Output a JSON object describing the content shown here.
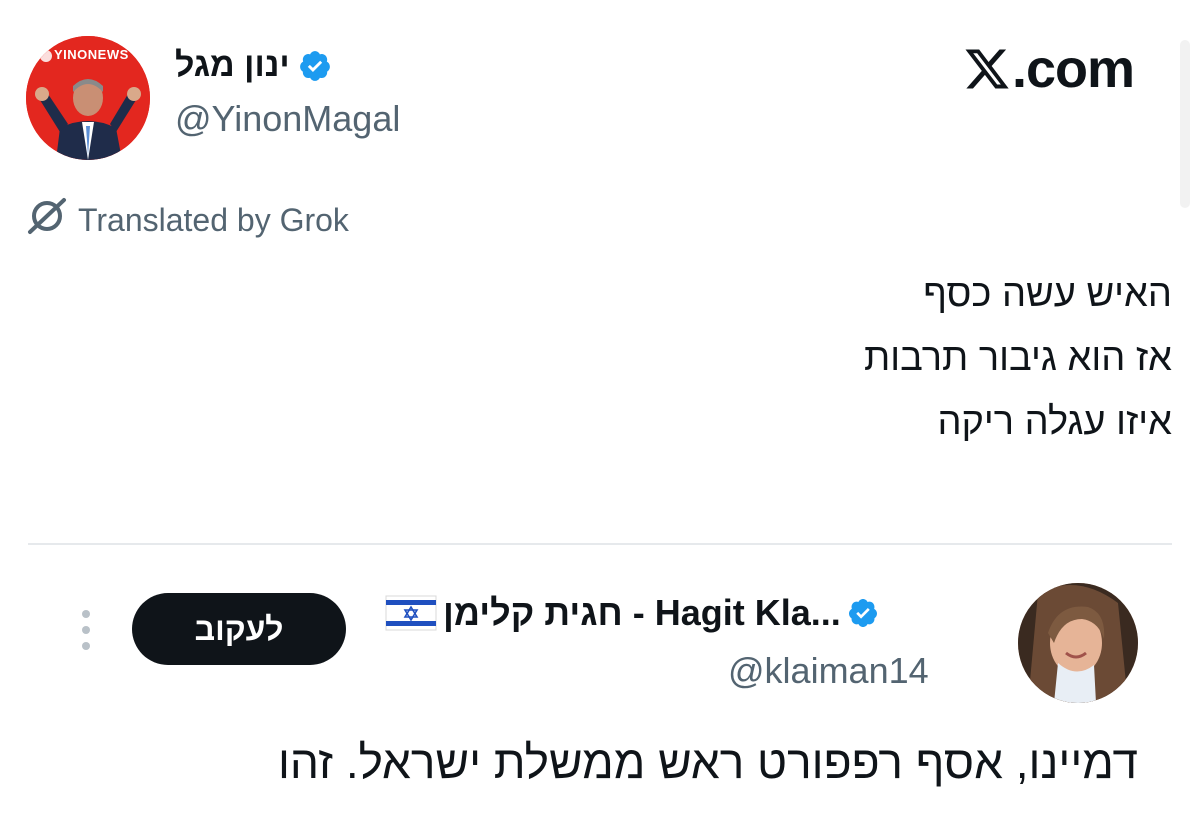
{
  "author": {
    "display_name": "ינון מגל",
    "handle": "@YinonMagal",
    "verified": true,
    "avatar_badge": "YINONEWS"
  },
  "site": {
    "label": ".com",
    "logo": "x-logo"
  },
  "translation_note": {
    "label": "Translated by Grok",
    "icon": "grok-icon"
  },
  "tweet": {
    "lines": [
      "האיש עשה כסף",
      "אז הוא גיבור תרבות",
      "איזו עגלה ריקה"
    ]
  },
  "quoted": {
    "display_name": "חגית קלימן - Hagit Kla...",
    "handle": "@klaiman14",
    "verified": true,
    "flag": "israel-flag",
    "follow_label": "לעקוב",
    "text": "דמיינו, אסף רפפורט ראש ממשלת ישראל. זהו"
  },
  "colors": {
    "verified_blue": "#1d9bf0",
    "text_primary": "#0f1419",
    "text_secondary": "#536471",
    "avatar_red": "#e3271f"
  }
}
